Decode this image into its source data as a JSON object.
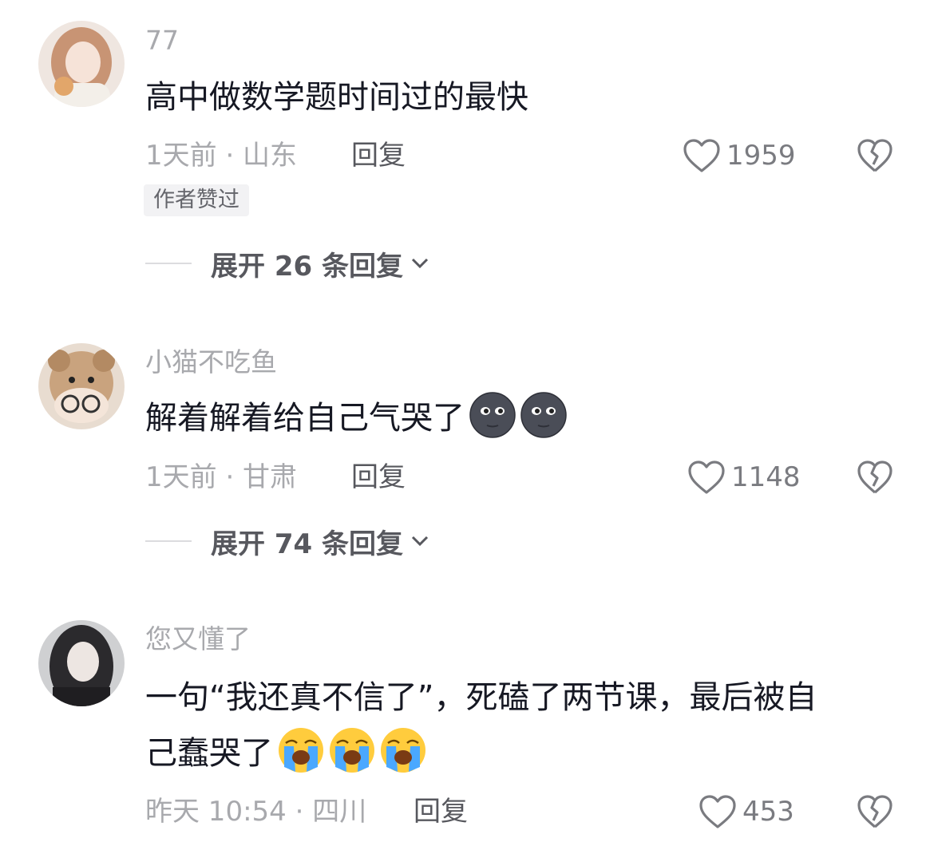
{
  "comments": [
    {
      "username": "77",
      "text": "高中做数学题时间过的最快",
      "time_location": "1天前 · 山东",
      "reply_label": "回复",
      "likes": "1959",
      "badge": "作者赞过",
      "expand_label": "展开 26 条回复"
    },
    {
      "username": "小猫不吃鱼",
      "text": "解着解着给自己气哭了",
      "emoji": [
        "new-moon-face-emoji",
        "new-moon-face-emoji"
      ],
      "time_location": "1天前 · 甘肃",
      "reply_label": "回复",
      "likes": "1148",
      "expand_label": "展开 74 条回复"
    },
    {
      "username": "您又懂了",
      "text_line1": "一句“我还真不信了”，死磕了两节课，最后被自",
      "text_line2": "己蠢哭了",
      "emoji": [
        "loudly-crying-face-emoji",
        "loudly-crying-face-emoji",
        "loudly-crying-face-emoji"
      ],
      "time_location": "昨天 10:54 · 四川",
      "reply_label": "回复",
      "likes": "453"
    }
  ],
  "icons": {
    "like": "heart-outline-icon",
    "dislike": "broken-heart-icon",
    "expand": "chevron-down-icon"
  },
  "colors": {
    "primary_text": "#161823",
    "secondary_text": "#a8a9ad",
    "action_text": "#57585e",
    "badge_bg": "#f2f2f4"
  }
}
